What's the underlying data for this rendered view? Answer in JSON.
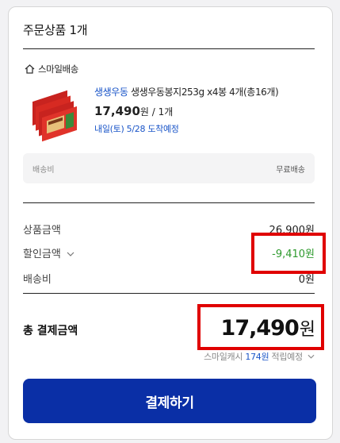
{
  "order": {
    "title": "주문상품 1개",
    "store": "스마일배송",
    "product": {
      "brand": "생생우동",
      "name": "생생우동봉지253g x4봉 4개(총16개)",
      "price": "17,490",
      "price_unit": "원",
      "quantity": "/ 1개",
      "delivery": "내일(토) 5/28 도착예정"
    },
    "shipping": {
      "label": "배송비",
      "value": "무료배송"
    }
  },
  "summary": {
    "product_amount_label": "상품금액",
    "product_amount": "26,900원",
    "discount_label": "할인금액",
    "discount_amount": "-9,410원",
    "shipping_label": "배송비",
    "shipping_amount": "0원",
    "total_label": "총 결제금액",
    "total_amount": "17,490",
    "total_unit": "원",
    "points_prefix": "스마일캐시",
    "points_amount": "174원",
    "points_suffix": "적립예정"
  },
  "pay_button": "결제하기",
  "colors": {
    "accent": "#0a2fa6",
    "link": "#1a55c8",
    "discount": "#2e9a2e",
    "highlight": "#e00000"
  }
}
